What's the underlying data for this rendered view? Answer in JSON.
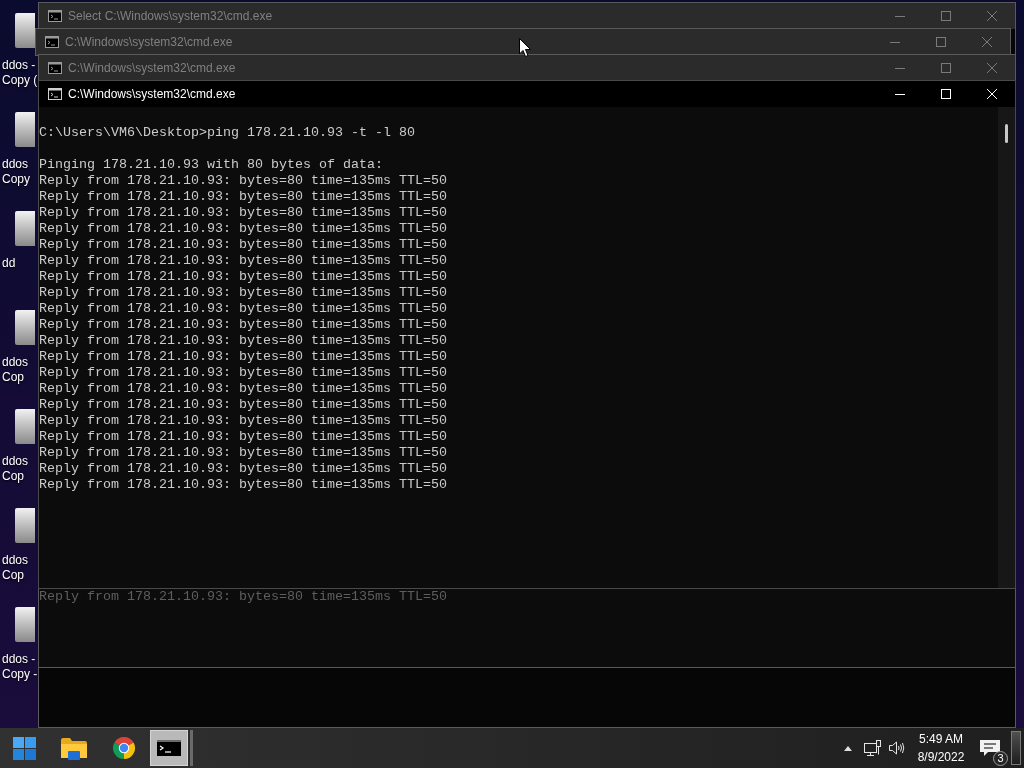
{
  "desktop_icons": [
    {
      "label_lines": [
        "ddos -",
        "Copy ("
      ]
    },
    {
      "label_lines": [
        "ddos",
        "Copy"
      ]
    },
    {
      "label_lines": [
        "dd"
      ]
    },
    {
      "label_lines": [
        "ddos",
        "Cop"
      ]
    },
    {
      "label_lines": [
        "ddos",
        "Cop"
      ]
    },
    {
      "label_lines": [
        "ddos",
        "Cop"
      ]
    },
    {
      "label_lines": [
        "ddos -",
        "Copy -"
      ]
    }
  ],
  "windows": [
    {
      "title": "Select C:\\Windows\\system32\\cmd.exe",
      "active": false
    },
    {
      "title": "C:\\Windows\\system32\\cmd.exe",
      "active": false
    },
    {
      "title": "C:\\Windows\\system32\\cmd.exe",
      "active": false,
      "console": {
        "output_lines": [
          "Reply from 178.21.10.93: bytes=80 time=135ms TTL=50"
        ]
      }
    },
    {
      "title": "C:\\Windows\\system32\\cmd.exe",
      "active": true,
      "console": {
        "prompt_line": "C:\\Users\\VM6\\Desktop>ping 178.21.10.93 -t -l 80",
        "output_lines": [
          "Pinging 178.21.10.93 with 80 bytes of data:",
          "Reply from 178.21.10.93: bytes=80 time=135ms TTL=50",
          "Reply from 178.21.10.93: bytes=80 time=135ms TTL=50",
          "Reply from 178.21.10.93: bytes=80 time=135ms TTL=50",
          "Reply from 178.21.10.93: bytes=80 time=135ms TTL=50",
          "Reply from 178.21.10.93: bytes=80 time=135ms TTL=50",
          "Reply from 178.21.10.93: bytes=80 time=135ms TTL=50",
          "Reply from 178.21.10.93: bytes=80 time=135ms TTL=50",
          "Reply from 178.21.10.93: bytes=80 time=135ms TTL=50",
          "Reply from 178.21.10.93: bytes=80 time=135ms TTL=50",
          "Reply from 178.21.10.93: bytes=80 time=135ms TTL=50",
          "Reply from 178.21.10.93: bytes=80 time=135ms TTL=50",
          "Reply from 178.21.10.93: bytes=80 time=135ms TTL=50",
          "Reply from 178.21.10.93: bytes=80 time=135ms TTL=50",
          "Reply from 178.21.10.93: bytes=80 time=135ms TTL=50",
          "Reply from 178.21.10.93: bytes=80 time=135ms TTL=50",
          "Reply from 178.21.10.93: bytes=80 time=135ms TTL=50",
          "Reply from 178.21.10.93: bytes=80 time=135ms TTL=50",
          "Reply from 178.21.10.93: bytes=80 time=135ms TTL=50",
          "Reply from 178.21.10.93: bytes=80 time=135ms TTL=50",
          "Reply from 178.21.10.93: bytes=80 time=135ms TTL=50"
        ]
      }
    }
  ],
  "taskbar": {
    "apps": [
      {
        "kind": "start",
        "selected": false
      },
      {
        "kind": "file_explorer",
        "selected": false
      },
      {
        "kind": "browser",
        "selected": false
      },
      {
        "kind": "terminal",
        "selected": true
      }
    ],
    "tray": [
      {
        "kind": "overflow"
      },
      {
        "kind": "network"
      },
      {
        "kind": "volume"
      }
    ],
    "clock": {
      "time": "5:49 AM",
      "date": "8/9/2022"
    },
    "notifications": {
      "badge": "3"
    }
  }
}
